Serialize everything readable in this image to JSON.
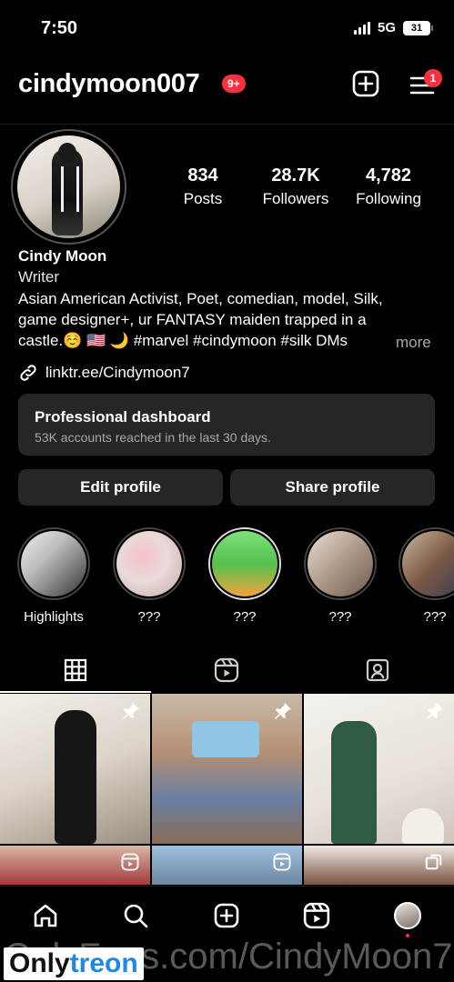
{
  "status": {
    "time": "7:50",
    "network": "5G",
    "battery": "31"
  },
  "header": {
    "username": "cindymoon007",
    "notif_badge": "9+",
    "menu_badge": "1"
  },
  "stats": [
    {
      "value": "834",
      "label": "Posts"
    },
    {
      "value": "28.7K",
      "label": "Followers"
    },
    {
      "value": "4,782",
      "label": "Following"
    }
  ],
  "bio": {
    "name": "Cindy Moon",
    "category": "Writer",
    "line1": "Asian American Activist, Poet, comedian, model, Silk,",
    "line2": "game designer+, ur FANTASY maiden trapped in a",
    "line3": "castle.☺️ 🇺🇸 🌙 #marvel #cindymoon #silk DMs",
    "more": "more",
    "link": "linktr.ee/Cindymoon7"
  },
  "dashboard": {
    "title": "Professional dashboard",
    "subtitle": "53K accounts reached in the last 30 days."
  },
  "buttons": {
    "edit": "Edit profile",
    "share": "Share profile"
  },
  "highlights": [
    {
      "label": "Highlights"
    },
    {
      "label": "???"
    },
    {
      "label": "???"
    },
    {
      "label": "???"
    },
    {
      "label": "???"
    }
  ],
  "tabs": [
    "grid-icon",
    "reels-icon",
    "tagged-icon"
  ],
  "nav": [
    "home-icon",
    "search-icon",
    "create-icon",
    "reels-icon",
    "profile-avatar"
  ],
  "watermark": {
    "text": "OnlyFans.com/CindyMoon7",
    "logo_a": "Only",
    "logo_b": "treon"
  }
}
